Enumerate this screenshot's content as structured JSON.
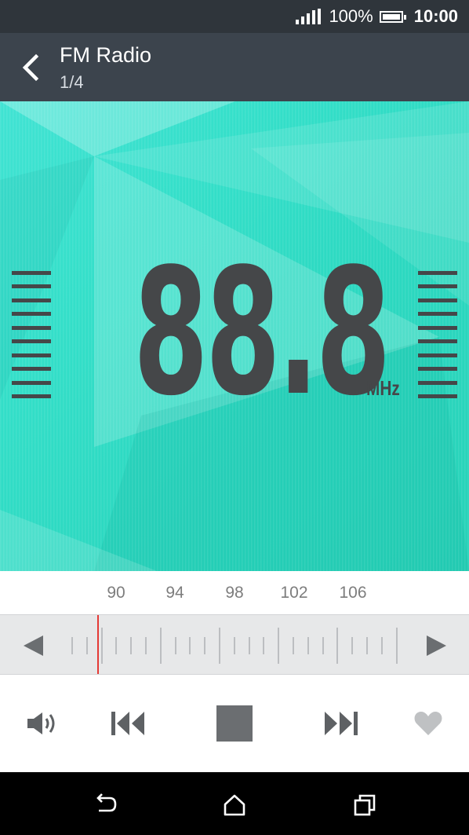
{
  "status_bar": {
    "battery_percent": "100%",
    "battery_level": 1.0,
    "time": "10:00",
    "icons": [
      "signal-icon",
      "battery-icon"
    ]
  },
  "header": {
    "title": "FM Radio",
    "subtitle": "1/4",
    "back_icon": "back-arrow-icon"
  },
  "tuner": {
    "frequency": "88.8",
    "unit": "MHz",
    "hero_color": "#34dfc9"
  },
  "scale": {
    "labels": [
      "90",
      "94",
      "98",
      "102",
      "106"
    ],
    "needle_color": "#e53935",
    "left_icon": "scan-left-icon",
    "right_icon": "scan-right-icon"
  },
  "controls": {
    "icons": [
      "volume-icon",
      "previous-icon",
      "stop-icon",
      "next-icon",
      "favorite-icon"
    ]
  },
  "nav_bar": {
    "icons": [
      "nav-back-icon",
      "nav-home-icon",
      "nav-recents-icon"
    ]
  }
}
